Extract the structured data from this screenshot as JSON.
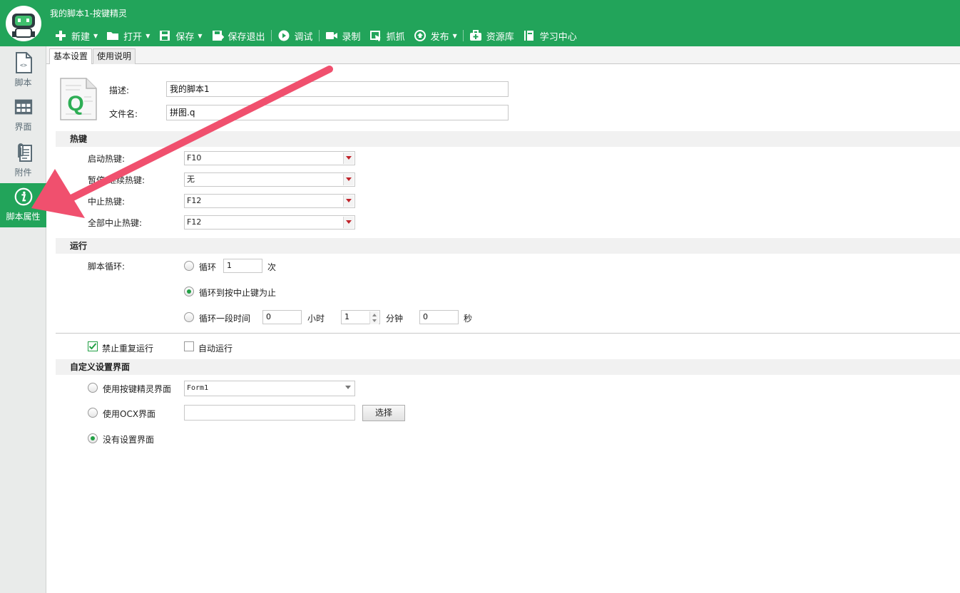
{
  "app": {
    "title": "我的脚本1-按键精灵"
  },
  "toolbar": {
    "items": [
      {
        "label": "新建",
        "icon": "plus-icon",
        "dropdown": true
      },
      {
        "label": "打开",
        "icon": "folder-icon",
        "dropdown": true
      },
      {
        "label": "保存",
        "icon": "save-icon",
        "dropdown": true
      },
      {
        "label": "保存退出",
        "icon": "save-exit-icon",
        "dropdown": false
      },
      {
        "label": "调试",
        "icon": "play-icon",
        "dropdown": false
      },
      {
        "label": "录制",
        "icon": "camera-icon",
        "dropdown": false
      },
      {
        "label": "抓抓",
        "icon": "grab-icon",
        "dropdown": false
      },
      {
        "label": "发布",
        "icon": "publish-icon",
        "dropdown": true
      },
      {
        "label": "资源库",
        "icon": "resource-icon",
        "dropdown": false
      },
      {
        "label": "学习中心",
        "icon": "book-icon",
        "dropdown": false
      }
    ]
  },
  "sidebar": {
    "items": [
      {
        "label": "脚本",
        "icon": "script-file-icon",
        "active": false
      },
      {
        "label": "界面",
        "icon": "window-grid-icon",
        "active": false
      },
      {
        "label": "附件",
        "icon": "attachment-icon",
        "active": false
      },
      {
        "label": "脚本属性",
        "icon": "info-icon",
        "active": true
      }
    ]
  },
  "tabs": [
    {
      "label": "基本设置",
      "active": true
    },
    {
      "label": "使用说明",
      "active": false
    }
  ],
  "basic": {
    "description_label": "描述:",
    "description_value": "我的脚本1",
    "filename_label": "文件名:",
    "filename_value": "拼图.q",
    "file_icon_letter": "Q"
  },
  "hotkeys": {
    "section_title": "热键",
    "rows": [
      {
        "label": "启动热键:",
        "value": "F10"
      },
      {
        "label": "暂停/继续热键:",
        "value": "无"
      },
      {
        "label": "中止热键:",
        "value": "F12"
      },
      {
        "label": "全部中止热键:",
        "value": "F12"
      }
    ]
  },
  "run": {
    "section_title": "运行",
    "loop_label": "脚本循环:",
    "loop_count_option": "循环",
    "loop_count_value": "1",
    "loop_count_unit": "次",
    "loop_until_stop_option": "循环到按中止键为止",
    "loop_duration_option": "循环一段时间",
    "hours_value": "0",
    "hours_unit": "小时",
    "minutes_value": "1",
    "minutes_unit": "分钟",
    "seconds_value": "0",
    "seconds_unit": "秒",
    "selected": "loop_until_stop"
  },
  "options": {
    "no_repeat_label": "禁止重复运行",
    "no_repeat_checked": true,
    "auto_run_label": "自动运行",
    "auto_run_checked": false
  },
  "ui_settings": {
    "section_title": "自定义设置界面",
    "use_builtin_label": "使用按键精灵界面",
    "builtin_form_value": "Form1",
    "use_ocx_label": "使用OCX界面",
    "ocx_value": "",
    "select_button": "选择",
    "no_ui_label": "没有设置界面",
    "selected": "none"
  },
  "colors": {
    "brand_green": "#22a45a",
    "arrow_red": "#f0506e"
  }
}
